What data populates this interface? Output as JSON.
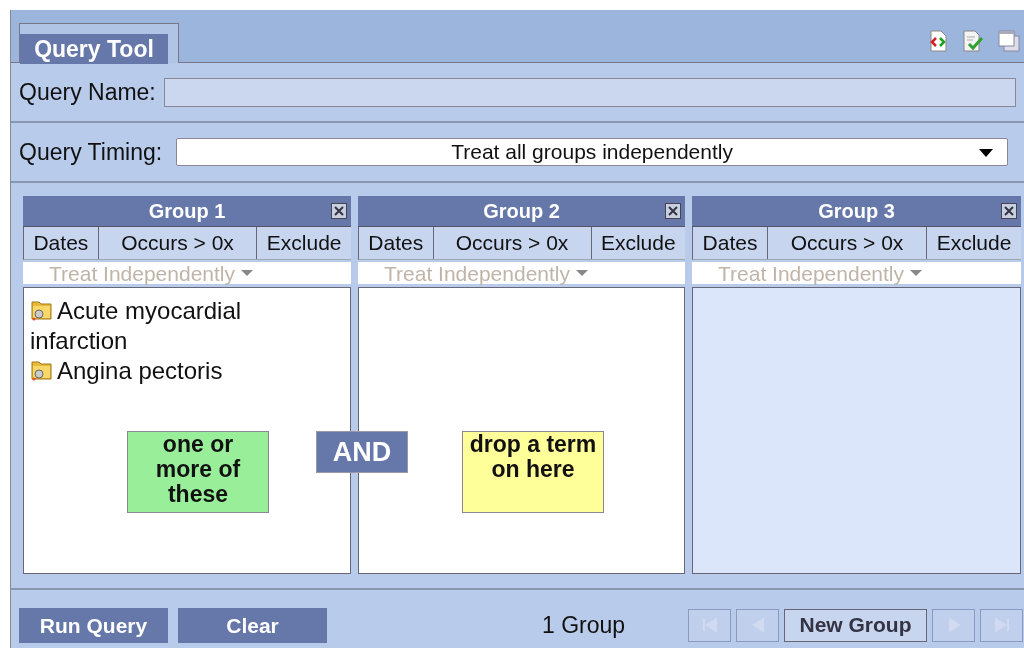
{
  "tab": {
    "label": "Query Tool",
    "selected": true
  },
  "query_name": {
    "label": "Query Name:"
  },
  "query_timing": {
    "label": "Query Timing:",
    "value": "Treat all groups independently"
  },
  "groups": [
    {
      "title": "Group 1",
      "active": true,
      "buttons": [
        "Dates",
        "Occurs > 0x",
        "Exclude"
      ],
      "timing": "Treat Independently",
      "items": [
        {
          "label": "Acute myocardial infarction"
        },
        {
          "label": "Angina pectoris"
        }
      ],
      "hint": {
        "text": "one or more of these",
        "color": "#99ee99"
      }
    },
    {
      "title": "Group 2",
      "active": true,
      "buttons": [
        "Dates",
        "Occurs > 0x",
        "Exclude"
      ],
      "timing": "Treat Independently",
      "hint": {
        "text": "drop a term on here",
        "color": "#ffff99"
      }
    },
    {
      "title": "Group 3",
      "active": false,
      "buttons": [
        "Dates",
        "Occurs > 0x",
        "Exclude"
      ],
      "timing": "Treat Independently"
    }
  ],
  "connector": {
    "label": "AND"
  },
  "footer": {
    "buttons": [
      "Run Query",
      "Clear"
    ],
    "group_count": "1 Group",
    "nav": [
      {
        "kind": "first",
        "disabled": true
      },
      {
        "kind": "prev",
        "disabled": true
      },
      {
        "kind": "new",
        "label": "New Group",
        "disabled": false
      },
      {
        "kind": "next",
        "disabled": true
      },
      {
        "kind": "last",
        "disabled": true
      }
    ]
  }
}
